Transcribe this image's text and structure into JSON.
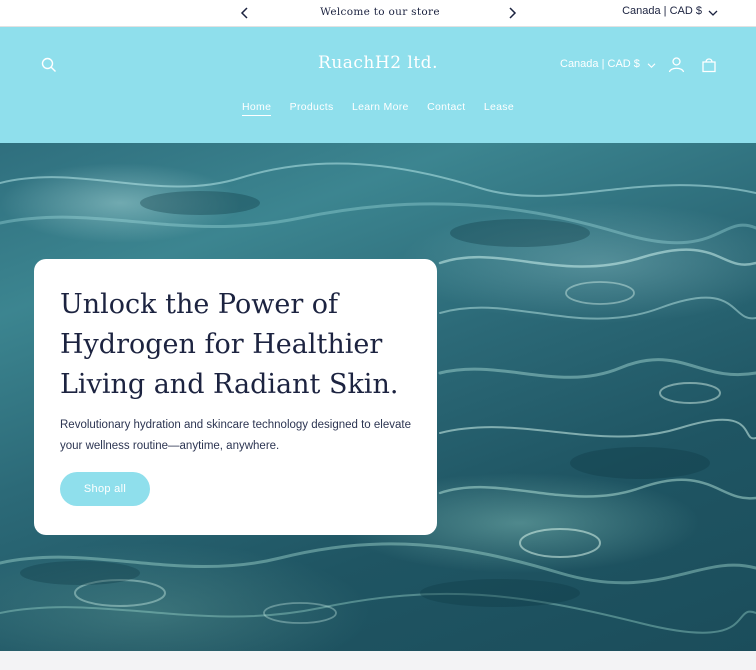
{
  "announcement": {
    "message": "Welcome to our store",
    "prev_icon": "chevron-left-icon",
    "next_icon": "chevron-right-icon",
    "currency": "Canada | CAD $"
  },
  "header": {
    "logo": "RuachH2 ltd.",
    "currency": "Canada | CAD $",
    "icons": [
      "search-icon",
      "chevron-down-icon",
      "account-icon",
      "cart-icon"
    ],
    "nav": [
      {
        "label": "Home",
        "active": true
      },
      {
        "label": "Products",
        "active": false
      },
      {
        "label": "Learn More",
        "active": false
      },
      {
        "label": "Contact",
        "active": false
      },
      {
        "label": "Lease",
        "active": false
      }
    ]
  },
  "hero": {
    "heading": "Unlock the Power of Hydrogen for Healthier Living and Radiant Skin.",
    "subtext": "Revolutionary hydration and skincare technology designed to elevate your wellness routine—anytime, anywhere.",
    "button": "Shop all"
  },
  "colors": {
    "accent": "#8fdfec",
    "text": "#1c2340",
    "white": "#ffffff"
  }
}
